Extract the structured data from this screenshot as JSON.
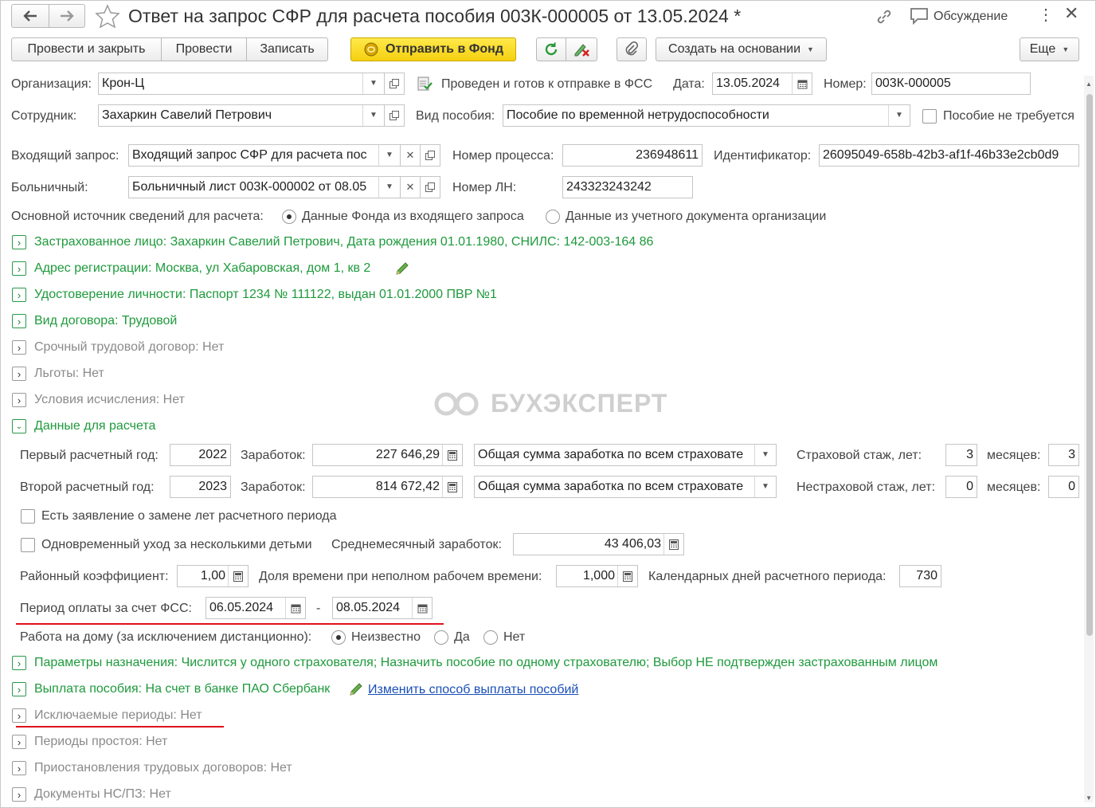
{
  "window": {
    "title": "Ответ на запрос СФР для расчета пособия 003К-000005 от 13.05.2024 *",
    "discussion_label": "Обсуждение"
  },
  "toolbar": {
    "post_close": "Провести и закрыть",
    "post": "Провести",
    "write": "Записать",
    "send_fund": "Отправить в Фонд",
    "create_based": "Создать на основании",
    "more": "Еще"
  },
  "form": {
    "org_label": "Организация:",
    "org_value": "Крон-Ц",
    "status_text": "Проведен и готов к отправке в ФСС",
    "date_label": "Дата:",
    "date_value": "13.05.2024",
    "number_label": "Номер:",
    "number_value": "003К-000005",
    "employee_label": "Сотрудник:",
    "employee_value": "Захаркин Савелий Петрович",
    "benefit_type_label": "Вид пособия:",
    "benefit_type_value": "Пособие по временной нетрудоспособности",
    "benefit_not_required": "Пособие не требуется",
    "incoming_label": "Входящий запрос:",
    "incoming_value": "Входящий запрос СФР для расчета пос",
    "process_label": "Номер процесса:",
    "process_value": "236948611",
    "identifier_label": "Идентификатор:",
    "identifier_value": "26095049-658b-42b3-af1f-46b33e2cb0d9",
    "sick_label": "Больничный:",
    "sick_value": "Больничный лист 003К-000002 от 08.05",
    "ln_label": "Номер ЛН:",
    "ln_value": "243323243242",
    "source_label": "Основной источник сведений для расчета:",
    "source_opt1": "Данные Фонда из входящего запроса",
    "source_opt2": "Данные из учетного документа организации"
  },
  "groups": {
    "insured": "Застрахованное лицо: Захаркин Савелий Петрович, Дата рождения 01.01.1980, СНИЛС: 142-003-164 86",
    "address": "Адрес регистрации: Москва, ул Хабаровская, дом 1, кв 2",
    "identity": "Удостоверение личности: Паспорт 1234 № 111122, выдан 01.01.2000 ПВР №1",
    "contract": "Вид договора: Трудовой",
    "fixed_term": "Срочный трудовой договор: Нет",
    "benefits": "Льготы: Нет",
    "conditions": "Условия исчисления: Нет",
    "calc_data": "Данные для расчета",
    "params": "Параметры назначения: Числится у одного страхователя; Назначить пособие по одному страхователю; Выбор НЕ подтвержден застрахованным лицом",
    "payment": "Выплата пособия: На счет в банке ПАО Сбербанк",
    "payment_link": "Изменить способ выплаты пособий",
    "excluded": "Исключаемые периоды: Нет",
    "downtime": "Периоды простоя: Нет",
    "suspensions": "Приостановления трудовых договоров: Нет",
    "accident_docs": "Документы НС/ПЗ: Нет"
  },
  "calc": {
    "year1_label": "Первый расчетный год:",
    "year1": "2022",
    "earn_label": "Заработок:",
    "earn1": "227 646,29",
    "earn_kind1": "Общая сумма заработка по всем страховате",
    "ins_exp_label": "Страховой стаж, лет:",
    "ins_exp_years": "3",
    "months_label": "месяцев:",
    "ins_exp_months": "3",
    "year2_label": "Второй расчетный год:",
    "year2": "2023",
    "earn2": "814 672,42",
    "earn_kind2": "Общая сумма заработка по всем страховате",
    "nonins_exp_label": "Нестраховой стаж, лет:",
    "nonins_exp_years": "0",
    "nonins_exp_months": "0",
    "replace_years": "Есть заявление о замене лет расчетного периода",
    "multi_children": "Одновременный уход за несколькими детьми",
    "avg_label": "Среднемесячный заработок:",
    "avg_value": "43 406,03",
    "region_label": "Районный коэффициент:",
    "region_value": "1,00",
    "part_label": "Доля времени при неполном рабочем времени:",
    "part_value": "1,000",
    "days_label": "Календарных дней расчетного периода:",
    "days_value": "730",
    "period_label": "Период оплаты за счет ФСС:",
    "period_from": "06.05.2024",
    "period_dash": "-",
    "period_to": "08.05.2024",
    "home_label": "Работа на дому (за исключением дистанционно):",
    "home_opt1": "Неизвестно",
    "home_opt2": "Да",
    "home_opt3": "Нет"
  },
  "watermark": "БУХЭКСПЕРТ"
}
